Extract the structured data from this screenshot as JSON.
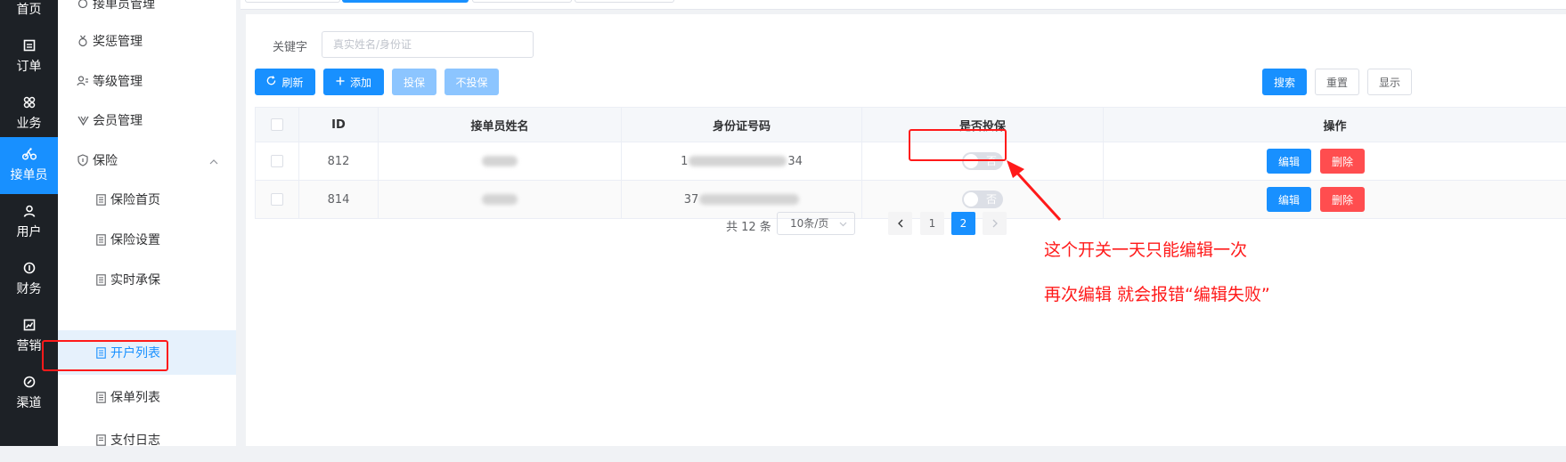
{
  "rail": [
    {
      "label": "首页",
      "icon": "home-icon"
    },
    {
      "label": "订单",
      "icon": "order-icon"
    },
    {
      "label": "业务",
      "icon": "business-icon"
    },
    {
      "label": "接单员",
      "icon": "bike-icon"
    },
    {
      "label": "用户",
      "icon": "user-icon"
    },
    {
      "label": "财务",
      "icon": "finance-icon"
    },
    {
      "label": "营销",
      "icon": "marketing-icon"
    },
    {
      "label": "渠道",
      "icon": "channel-icon"
    }
  ],
  "submenu": {
    "items": [
      {
        "label": "接单员管理"
      },
      {
        "label": "奖惩管理"
      },
      {
        "label": "等级管理"
      },
      {
        "label": "会员管理"
      },
      {
        "label": "保险"
      },
      {
        "label": "保险首页"
      },
      {
        "label": "保险设置"
      },
      {
        "label": "实时承保"
      },
      {
        "label": "开户列表"
      },
      {
        "label": "保单列表"
      },
      {
        "label": "支付日志"
      }
    ]
  },
  "search": {
    "keyword_label": "关键字",
    "keyword_placeholder": "真实姓名/身份证"
  },
  "toolbar": {
    "refresh": "刷新",
    "add": "添加",
    "insure": "投保",
    "no_insure": "不投保",
    "search": "搜索",
    "reset": "重置",
    "display": "显示"
  },
  "table": {
    "headers": [
      "ID",
      "接单员姓名",
      "身份证号码",
      "是否投保",
      "操作"
    ],
    "rows": [
      {
        "id": "812",
        "id_card_start": "1",
        "id_card_end": "34",
        "insured": "否",
        "edit": "编辑",
        "delete": "删除"
      },
      {
        "id": "814",
        "id_card_start": "37",
        "id_card_end": "",
        "insured": "否",
        "edit": "编辑",
        "delete": "删除"
      }
    ]
  },
  "pagination": {
    "total": "共 12 条",
    "page_size": "10条/页",
    "pages": [
      "1",
      "2"
    ],
    "current": "2"
  },
  "annotations": {
    "line1": "这个开关一天只能编辑一次",
    "line2": "再次编辑 就会报错“编辑失败”"
  },
  "colors": {
    "primary": "#1890ff",
    "danger": "#ff4d4f",
    "annotation": "#ff1a1a",
    "rail_bg": "#1d2126"
  }
}
